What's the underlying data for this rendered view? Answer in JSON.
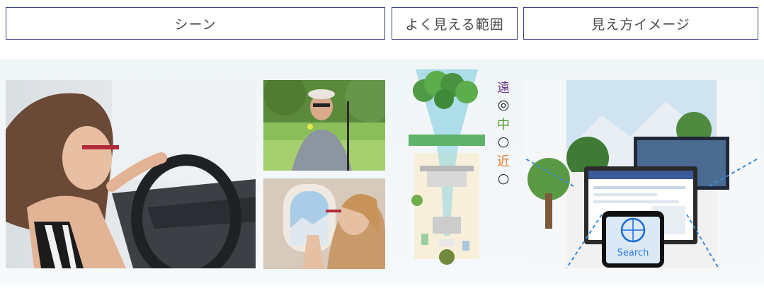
{
  "headers": {
    "scene": "シーン",
    "visible_range": "よく見える範囲",
    "view_image": "見え方イメージ"
  },
  "distance_legend": {
    "far": {
      "label": "遠",
      "mark": "◎"
    },
    "mid": {
      "label": "中",
      "mark": "○"
    },
    "near": {
      "label": "近",
      "mark": "○"
    }
  },
  "phone_screen": {
    "search_text": "Search"
  },
  "colors": {
    "header_border": "#3b3f88",
    "far": "#6b3c8f",
    "mid": "#4f9b2b",
    "near": "#e57a2a",
    "fov_cone": "#8fd3e3"
  }
}
